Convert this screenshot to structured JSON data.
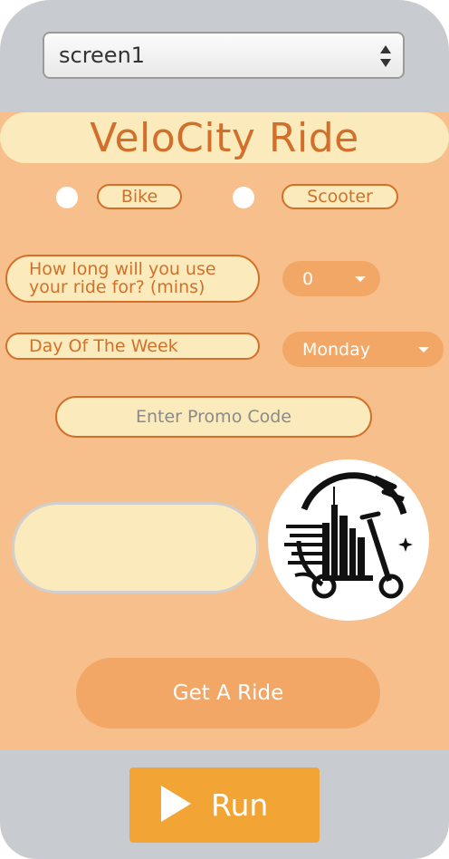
{
  "screen_selector": {
    "value": "screen1",
    "icon": "up-down-arrows-icon"
  },
  "app": {
    "title": "VeloCity Ride",
    "vehicle_options": [
      {
        "label": "Bike",
        "selected": false
      },
      {
        "label": "Scooter",
        "selected": false
      }
    ],
    "duration": {
      "question": "How long will you use your ride for? (mins)",
      "value": "0"
    },
    "day": {
      "question": "Day Of The Week",
      "value": "Monday"
    },
    "promo": {
      "placeholder": "Enter Promo Code",
      "value": ""
    },
    "result_text": "",
    "logo": "scooter-city-logo-icon",
    "get_ride_label": "Get A Ride"
  },
  "run": {
    "label": "Run",
    "icon": "play-icon"
  },
  "colors": {
    "app_background": "#f6bf8b",
    "accent": "#d2702b",
    "cream": "#fbeabb",
    "button": "#f2a766",
    "run_button": "#f2a535",
    "frame": "#c8ccd0"
  }
}
